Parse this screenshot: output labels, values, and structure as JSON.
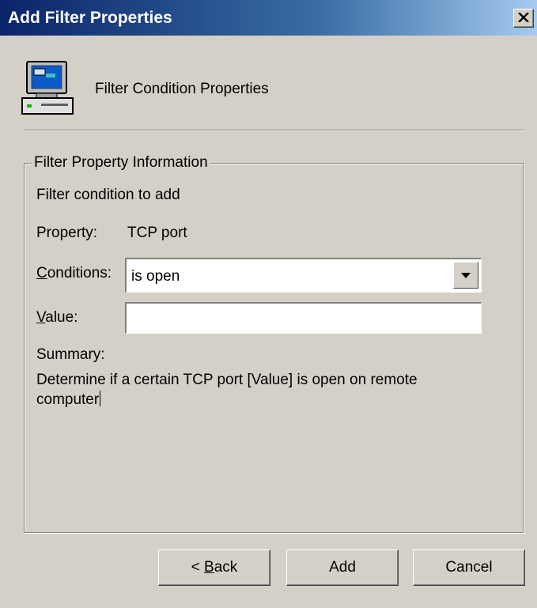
{
  "window": {
    "title": "Add Filter Properties"
  },
  "header": {
    "title": "Filter Condition Properties",
    "icon": "computer-icon"
  },
  "group": {
    "legend": "Filter Property Information",
    "intro": "Filter condition to add",
    "property_label": "Property:",
    "property_value": "TCP port",
    "conditions_label_accel": "C",
    "conditions_label_rest": "onditions:",
    "conditions_value": "is open",
    "value_label_accel": "V",
    "value_label_rest": "alue:",
    "value_input": "",
    "summary_label": "Summary:",
    "summary_text": "Determine if a certain TCP port [Value] is open on remote computer"
  },
  "buttons": {
    "back_prefix": "< ",
    "back_accel": "B",
    "back_rest": "ack",
    "add": "Add",
    "cancel": "Cancel"
  },
  "colors": {
    "dialog_bg": "#d4d0c8",
    "titlebar_start": "#0a246a",
    "titlebar_end": "#a6caf0"
  }
}
